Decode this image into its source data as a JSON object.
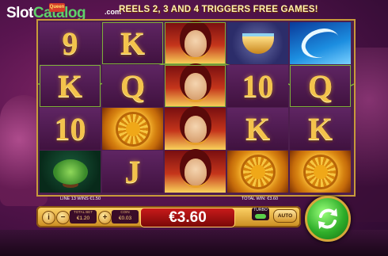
{
  "logo": {
    "slot": "Slot",
    "catalog": "Catalog",
    "badge": "Queen",
    "com": ".com"
  },
  "banner": "REELS 2, 3 AND 4 TRIGGERS FREE GAMES!",
  "reels": [
    [
      "9",
      "K",
      "goddess",
      "cup",
      "wave"
    ],
    [
      "K",
      "Q",
      "goddess",
      "10",
      "Q"
    ],
    [
      "10",
      "sun",
      "goddess",
      "K",
      "K"
    ],
    [
      "tree",
      "J",
      "goddess",
      "sun",
      "sun"
    ]
  ],
  "info": {
    "line_win": "LINE 13 WINS €1.50",
    "total_win": "TOTAL WIN: €3.60"
  },
  "controls": {
    "info_label": "i",
    "minus_label": "−",
    "plus_label": "+",
    "total_bet_label": "TOTAL BET",
    "total_bet_value": "€1.20",
    "coin_label": "COIN",
    "coin_value": "€0.03",
    "minus2_label": "−",
    "plus2_label": "+",
    "win_amount": "€3.60",
    "turbo_label": "TURBO",
    "auto_label": "AUTO"
  },
  "colors": {
    "gold": "#f3c34c",
    "win_line": "#7fb03a",
    "spin_green": "#2fae2a",
    "win_red": "#c81a1a"
  }
}
